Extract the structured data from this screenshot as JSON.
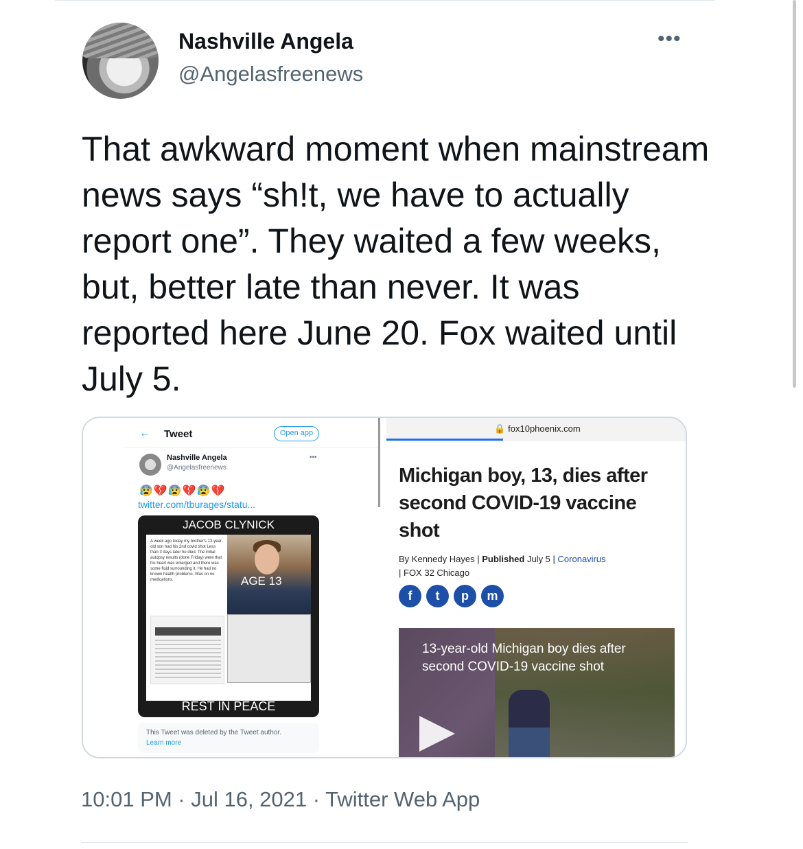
{
  "tweet": {
    "display_name": "Nashville Angela",
    "handle": "@Angelasfreenews",
    "more_label": "•••",
    "text": "That awkward moment when mainstream news says “sh!t, we have to actually report one”. They waited a few weeks, but, better late than never. It was reported here June 20. Fox waited until July 5.",
    "timestamp": "10:01 PM · Jul 16, 2021 · Twitter Web App"
  },
  "embedded_left": {
    "back_arrow": "←",
    "header": "Tweet",
    "open_app": "Open app",
    "name": "Nashville Angela",
    "handle": "@Angelasfreenews",
    "dots": "•••",
    "emojis": "😰💔😰💔😰💔",
    "link": "twitter.com/tburages/statu...",
    "card_title": "JACOB CLYNICK",
    "card_text": "A week ago today my brother's 13-year-old son had his 2nd covid shot Less than 3 days later he died. The initial autopsy results (done Friday) were that his heart was enlarged and there was some fluid surrounding it. He had no known health problems. Was on no medications.",
    "age": "AGE 13",
    "card_footer": "REST IN PEACE",
    "deleted_text": "This Tweet was deleted by the Tweet author.",
    "learn_more": "Learn more"
  },
  "embedded_right": {
    "url": "🔒 fox10phoenix.com",
    "headline": "Michigan boy, 13, dies after second COVID-19 vaccine shot",
    "byline_by": "By",
    "author": "Kennedy Hayes",
    "published_label": "Published",
    "published_date": "July 5",
    "category": "Coronavirus",
    "station": "FOX 32 Chicago",
    "share_icons": [
      "f",
      "t",
      "p",
      "m"
    ],
    "video_caption": "13-year-old Michigan boy dies after second COVID-19 vaccine shot"
  }
}
